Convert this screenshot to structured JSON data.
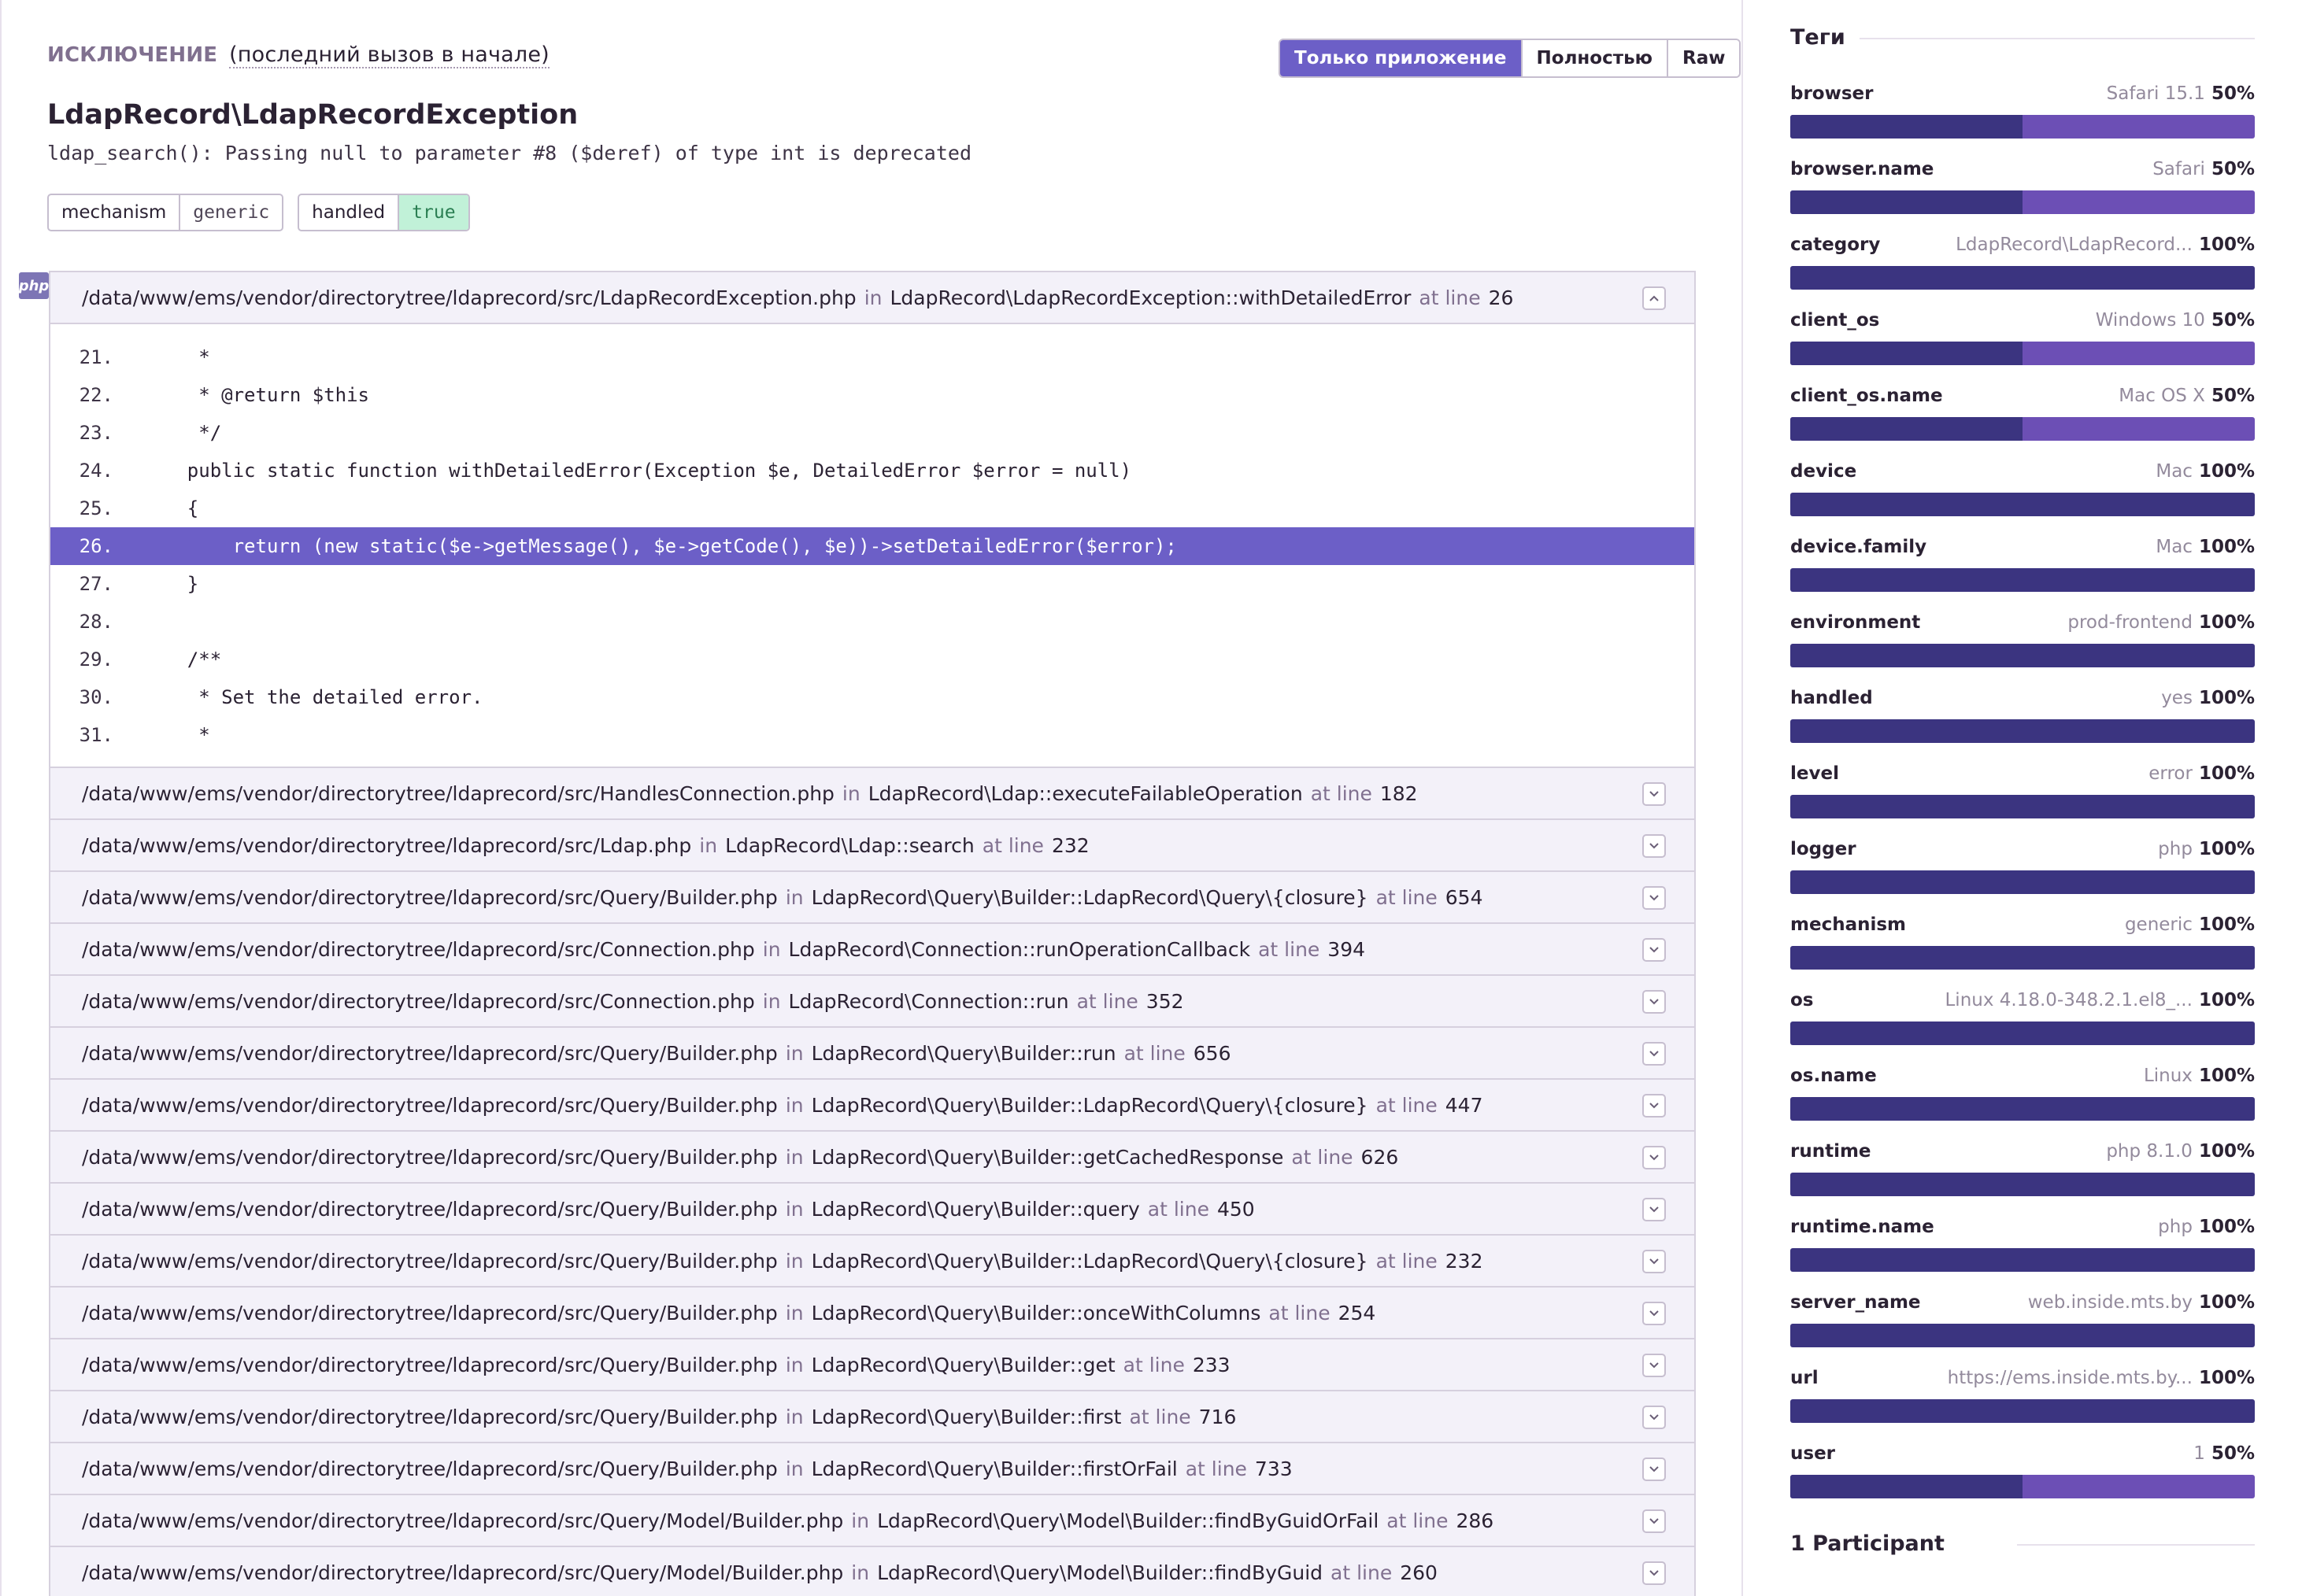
{
  "exception": {
    "label": "Исключение",
    "subtitle": "(последний вызов в начале)",
    "type": "LdapRecord\\LdapRecordException",
    "value": "ldap_search(): Passing null to parameter #8 ($deref) of type int is deprecated",
    "view_toggle": [
      "Только приложение",
      "Полностью",
      "Raw"
    ],
    "mechanism_pill": {
      "key": "mechanism",
      "value": "generic"
    },
    "handled_pill": {
      "key": "handled",
      "value": "true"
    },
    "platform_badge": "php"
  },
  "frames": {
    "in_word": "in",
    "at_line_word": "at line",
    "first": {
      "path": "/data/www/ems/vendor/directorytree/ldaprecord/src/LdapRecordException.php",
      "function": "LdapRecord\\LdapRecordException::withDetailedError",
      "line": "26"
    },
    "code": [
      {
        "n": "21.",
        "text": "     *"
      },
      {
        "n": "22.",
        "text": "     * @return $this"
      },
      {
        "n": "23.",
        "text": "     */"
      },
      {
        "n": "24.",
        "text": "    public static function withDetailedError(Exception $e, DetailedError $error = null)"
      },
      {
        "n": "25.",
        "text": "    {"
      },
      {
        "n": "26.",
        "text": "        return (new static($e->getMessage(), $e->getCode(), $e))->setDetailedError($error);"
      },
      {
        "n": "27.",
        "text": "    }"
      },
      {
        "n": "28.",
        "text": ""
      },
      {
        "n": "29.",
        "text": "    /**"
      },
      {
        "n": "30.",
        "text": "     * Set the detailed error."
      },
      {
        "n": "31.",
        "text": "     *"
      }
    ],
    "rest": [
      {
        "path": "/data/www/ems/vendor/directorytree/ldaprecord/src/HandlesConnection.php",
        "function": "LdapRecord\\Ldap::executeFailableOperation",
        "line": "182"
      },
      {
        "path": "/data/www/ems/vendor/directorytree/ldaprecord/src/Ldap.php",
        "function": "LdapRecord\\Ldap::search",
        "line": "232"
      },
      {
        "path": "/data/www/ems/vendor/directorytree/ldaprecord/src/Query/Builder.php",
        "function": "LdapRecord\\Query\\Builder::LdapRecord\\Query\\{closure}",
        "line": "654"
      },
      {
        "path": "/data/www/ems/vendor/directorytree/ldaprecord/src/Connection.php",
        "function": "LdapRecord\\Connection::runOperationCallback",
        "line": "394"
      },
      {
        "path": "/data/www/ems/vendor/directorytree/ldaprecord/src/Connection.php",
        "function": "LdapRecord\\Connection::run",
        "line": "352"
      },
      {
        "path": "/data/www/ems/vendor/directorytree/ldaprecord/src/Query/Builder.php",
        "function": "LdapRecord\\Query\\Builder::run",
        "line": "656"
      },
      {
        "path": "/data/www/ems/vendor/directorytree/ldaprecord/src/Query/Builder.php",
        "function": "LdapRecord\\Query\\Builder::LdapRecord\\Query\\{closure}",
        "line": "447"
      },
      {
        "path": "/data/www/ems/vendor/directorytree/ldaprecord/src/Query/Builder.php",
        "function": "LdapRecord\\Query\\Builder::getCachedResponse",
        "line": "626"
      },
      {
        "path": "/data/www/ems/vendor/directorytree/ldaprecord/src/Query/Builder.php",
        "function": "LdapRecord\\Query\\Builder::query",
        "line": "450"
      },
      {
        "path": "/data/www/ems/vendor/directorytree/ldaprecord/src/Query/Builder.php",
        "function": "LdapRecord\\Query\\Builder::LdapRecord\\Query\\{closure}",
        "line": "232"
      },
      {
        "path": "/data/www/ems/vendor/directorytree/ldaprecord/src/Query/Builder.php",
        "function": "LdapRecord\\Query\\Builder::onceWithColumns",
        "line": "254"
      },
      {
        "path": "/data/www/ems/vendor/directorytree/ldaprecord/src/Query/Builder.php",
        "function": "LdapRecord\\Query\\Builder::get",
        "line": "233"
      },
      {
        "path": "/data/www/ems/vendor/directorytree/ldaprecord/src/Query/Builder.php",
        "function": "LdapRecord\\Query\\Builder::first",
        "line": "716"
      },
      {
        "path": "/data/www/ems/vendor/directorytree/ldaprecord/src/Query/Builder.php",
        "function": "LdapRecord\\Query\\Builder::firstOrFail",
        "line": "733"
      },
      {
        "path": "/data/www/ems/vendor/directorytree/ldaprecord/src/Query/Model/Builder.php",
        "function": "LdapRecord\\Query\\Model\\Builder::findByGuidOrFail",
        "line": "286"
      },
      {
        "path": "/data/www/ems/vendor/directorytree/ldaprecord/src/Query/Model/Builder.php",
        "function": "LdapRecord\\Query\\Model\\Builder::findByGuid",
        "line": "260"
      }
    ]
  },
  "sidebar": {
    "tags_title": "Теги",
    "participants_title": "1 Participant",
    "tags": [
      {
        "key": "browser",
        "value": "Safari 15.1",
        "percent": "50%",
        "fraction": 0.5
      },
      {
        "key": "browser.name",
        "value": "Safari",
        "percent": "50%",
        "fraction": 0.5
      },
      {
        "key": "category",
        "value": "LdapRecord\\LdapRecord...",
        "percent": "100%",
        "fraction": 1
      },
      {
        "key": "client_os",
        "value": "Windows 10",
        "percent": "50%",
        "fraction": 0.5
      },
      {
        "key": "client_os.name",
        "value": "Mac OS X",
        "percent": "50%",
        "fraction": 0.5
      },
      {
        "key": "device",
        "value": "Mac",
        "percent": "100%",
        "fraction": 1
      },
      {
        "key": "device.family",
        "value": "Mac",
        "percent": "100%",
        "fraction": 1
      },
      {
        "key": "environment",
        "value": "prod-frontend",
        "percent": "100%",
        "fraction": 1
      },
      {
        "key": "handled",
        "value": "yes",
        "percent": "100%",
        "fraction": 1
      },
      {
        "key": "level",
        "value": "error",
        "percent": "100%",
        "fraction": 1
      },
      {
        "key": "logger",
        "value": "php",
        "percent": "100%",
        "fraction": 1
      },
      {
        "key": "mechanism",
        "value": "generic",
        "percent": "100%",
        "fraction": 1
      },
      {
        "key": "os",
        "value": "Linux 4.18.0-348.2.1.el8_...",
        "percent": "100%",
        "fraction": 1
      },
      {
        "key": "os.name",
        "value": "Linux",
        "percent": "100%",
        "fraction": 1
      },
      {
        "key": "runtime",
        "value": "php 8.1.0",
        "percent": "100%",
        "fraction": 1
      },
      {
        "key": "runtime.name",
        "value": "php",
        "percent": "100%",
        "fraction": 1
      },
      {
        "key": "server_name",
        "value": "web.inside.mts.by",
        "percent": "100%",
        "fraction": 1
      },
      {
        "key": "url",
        "value": "https://ems.inside.mts.by...",
        "percent": "100%",
        "fraction": 1
      },
      {
        "key": "user",
        "value": "1",
        "percent": "50%",
        "fraction": 0.5
      }
    ]
  },
  "colors": {
    "accent": "#6c5fc7",
    "bar_primary": "#3b3480",
    "bar_secondary": "#6c4fb5",
    "handled_green": "#c1f1d8"
  }
}
